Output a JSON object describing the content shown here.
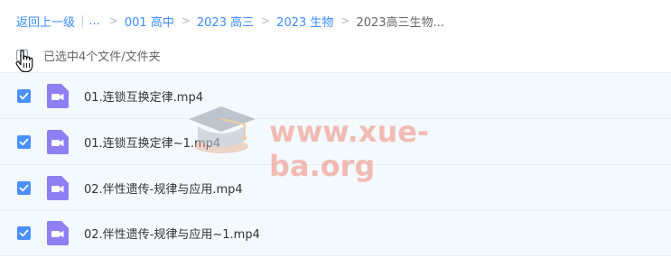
{
  "breadcrumb": {
    "back": "返回上一级",
    "sep": "|",
    "ellipsis": "...",
    "arrow": ">",
    "items": [
      "001 高中",
      "2023 高三",
      "2023 生物"
    ],
    "current": "2023高三生物..."
  },
  "selection": {
    "text": "已选中4个文件/文件夹",
    "state": "partial"
  },
  "files": [
    {
      "name": "01.连锁互换定律.mp4",
      "checked": true,
      "type": "video"
    },
    {
      "name": "01.连锁互换定律~1.mp4",
      "checked": true,
      "type": "video"
    },
    {
      "name": "02.伴性遗传-规律与应用.mp4",
      "checked": true,
      "type": "video"
    },
    {
      "name": "02.伴性遗传-规律与应用~1.mp4",
      "checked": true,
      "type": "video"
    }
  ],
  "watermark": {
    "text": "www.xue-ba.org",
    "icon": "graduation-cap-icon"
  },
  "colors": {
    "accent": "#3b8cff",
    "checkbox": "#4a90ff",
    "video_icon": "#8e7ff3",
    "row_bg": "#f4f9fe",
    "watermark": "#ee6e5a"
  }
}
